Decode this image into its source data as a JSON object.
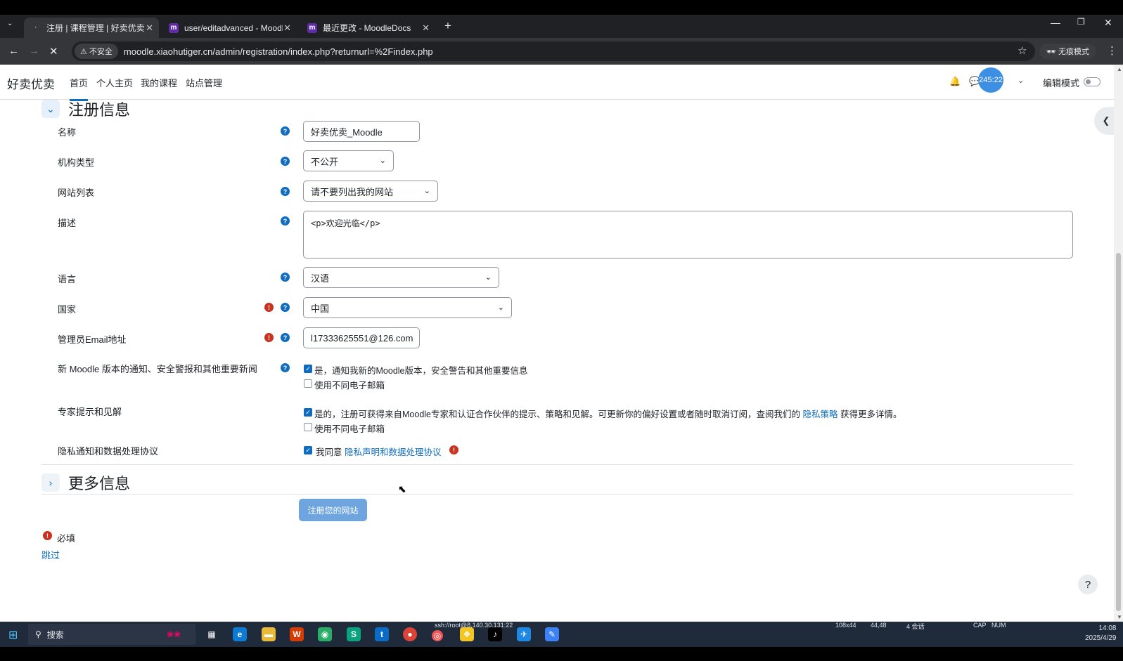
{
  "browser": {
    "tabs": [
      {
        "title": "注册 | 课程管理 | 好卖优卖",
        "active": true
      },
      {
        "title": "user/editadvanced - Moodle",
        "active": false
      },
      {
        "title": "最近更改 - MoodleDocs",
        "active": false
      }
    ],
    "insecure_label": "不安全",
    "url": "moodle.xiaohutiger.cn/admin/registration/index.php?returnurl=%2Findex.php",
    "incognito_label": "无痕模式"
  },
  "navbar": {
    "brand": "好卖优卖",
    "links": [
      "首页",
      "个人主页",
      "我的课程",
      "站点管理"
    ],
    "timer": "245:22",
    "edit_mode_label": "编辑模式"
  },
  "registration": {
    "section_title": "注册信息",
    "fields": {
      "name_label": "名称",
      "name_value": "好卖优卖_Moodle",
      "org_type_label": "机构类型",
      "org_type_value": "不公开",
      "site_list_label": "网站列表",
      "site_list_value": "请不要列出我的网站",
      "description_label": "描述",
      "description_value": "<p>欢迎光临</p>",
      "language_label": "语言",
      "language_value": "汉语",
      "country_label": "国家",
      "country_value": "中国",
      "email_label": "管理员Email地址",
      "email_value": "l17333625551@126.com",
      "notify_label": "新 Moodle 版本的通知、安全警报和其他重要新闻",
      "notify_check": "是，通知我新的Moodle版本，安全警告和其他重要信息",
      "notify_diff_email": "使用不同电子邮箱",
      "expert_label": "专家提示和见解",
      "expert_check": "是的，注册可获得来自Moodle专家和认证合作伙伴的提示、策略和见解。可更新你的偏好设置或者随时取消订阅，查阅我们的",
      "expert_link": "隐私策略",
      "expert_suffix": "获得更多详情。",
      "expert_diff_email": "使用不同电子邮箱",
      "privacy_label": "隐私通知和数据处理协议",
      "privacy_agree": "我同意",
      "privacy_link": "隐私声明和数据处理协议"
    }
  },
  "more_info": {
    "section_title": "更多信息"
  },
  "submit_label": "注册您的网站",
  "required_label": "必填",
  "skip_label": "跳过",
  "taskbar": {
    "search_label": "搜索",
    "terminal_title": "ssh://root@8.140.30.131:22",
    "term_size": "108x44",
    "term_pos": "44,48",
    "sessions": "4 会话",
    "cap": "CAP",
    "num": "NUM",
    "time": "14:08",
    "date": "2025/4/29"
  },
  "colors": {
    "accent": "#0f6cbf",
    "required": "#ca3120",
    "taskbar": "#1f2a3a"
  }
}
